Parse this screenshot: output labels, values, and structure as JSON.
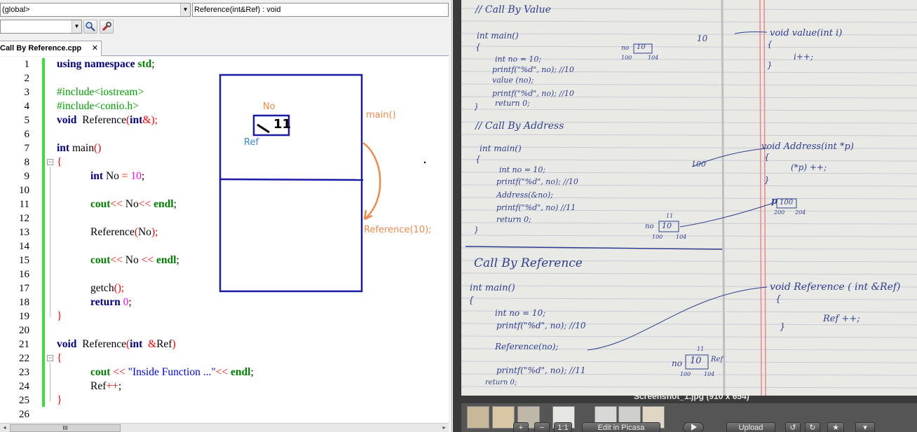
{
  "ide": {
    "scope_combo": "(global>",
    "function_combo": "Reference(int&Ref) : void",
    "search_icon": "search-icon",
    "tools_icon": "wrench-icon",
    "file_tab": "Call By Reference.cpp",
    "tab_close": "✕",
    "line_numbers": [
      "1",
      "2",
      "3",
      "4",
      "5",
      "6",
      "7",
      "8",
      "9",
      "10",
      "11",
      "12",
      "13",
      "14",
      "15",
      "16",
      "17",
      "18",
      "19",
      "20",
      "21",
      "22",
      "23",
      "24",
      "25",
      "26"
    ],
    "code": {
      "l1_kw1": "using",
      "l1_kw2": "namespace",
      "l1_std": "std",
      "l1_end": ";",
      "l3": "#include<iostream>",
      "l4": "#include<conio.h>",
      "l5_void": "void",
      "l5_name": "  Reference",
      "l5_open": "(",
      "l5_int": "int",
      "l5_amp": "&",
      "l5_close": ");",
      "l7_int": "int",
      "l7_main": " main",
      "l7_paren": "()",
      "l8": "{",
      "l9_int": "int",
      "l9_var": " No ",
      "l9_eq": "=",
      "l9_num": " 10",
      "l9_end": ";",
      "l11_cout": "cout",
      "l11_op1": "<<",
      "l11_var": " No",
      "l11_op2": "<<",
      "l11_endl": " endl",
      "l11_end": ";",
      "l13_call": "Reference",
      "l13_open": "(",
      "l13_arg": "No",
      "l13_close": ");",
      "l15_cout": "cout",
      "l15_op1": "<<",
      "l15_var": " No ",
      "l15_op2": "<<",
      "l15_endl": " endl",
      "l15_end": ";",
      "l17_call": "getch",
      "l17_paren": "();",
      "l18_ret": "return",
      "l18_num": " 0",
      "l18_end": ";",
      "l19": "}",
      "l21_void": "void",
      "l21_name": "  Reference",
      "l21_open": "(",
      "l21_int": "int",
      "l21_amp": "  &",
      "l21_ref": "Ref",
      "l21_close": ")",
      "l22": "{",
      "l23_cout": "cout",
      "l23_op1": " <<",
      "l23_str": " \"Inside Function ...\"",
      "l23_op2": "<<",
      "l23_endl": " endl",
      "l23_end": ";",
      "l24_ref": "Ref",
      "l24_op": "++",
      "l24_end": ";",
      "l25": "}"
    },
    "annotations": {
      "no_label": "No",
      "ref_label": "Ref",
      "cell_value": "11",
      "main_label": "main()",
      "call_label": "Reference(10);",
      "ink_blue": "#1a1aa6",
      "ink_orange": "#f08a4b",
      "ref_blue": "#3a86d6"
    },
    "scrollbar_grip": "III",
    "scroll_left": "◂",
    "scroll_right": "▸"
  },
  "viewer": {
    "caption": "Screenshot_1.jpg (910 x 654)",
    "buttons": {
      "plus": "+",
      "minus": "−",
      "one_to_one": "1:1",
      "edit": "Edit in Picasa",
      "upload": "Upload"
    },
    "notes": {
      "h1": "// Call By  Value",
      "h2": "// Call  By  Address",
      "h3": "Call  By  Reference",
      "v_main": "int main()",
      "v_brace": "{",
      "v1": "int no = 10;",
      "v2": "printf(\"%d\", no); //10",
      "v3": "value (no);",
      "v4": "printf(\"%d\", no); //10",
      "v5": "return 0;",
      "v_close": "}",
      "v_fn": "void  value(int i)",
      "v_fn_b": "{",
      "v_fn1": "i++;",
      "v_fn_c": "}",
      "a_main": "int main()",
      "a_brace": "{",
      "a1": "int no = 10;",
      "a2": "printf(\"%d\", no); //10",
      "a3": "Address(&no);",
      "a4": "printf(\"%d\", no) //11",
      "a5": "return 0;",
      "a_close": "}",
      "a_fn": "void  Address(int *p)",
      "a_fn_b": "{",
      "a_fn1": "(*p) ++;",
      "a_fn_c": "}",
      "r_main": "int  main()",
      "r_brace": "{",
      "r1": "int no = 10;",
      "r2": "printf(\"%d\", no); //10",
      "r3": "Reference(no);",
      "r4": "printf(\"%d\", no); //11",
      "r5": "return 0;",
      "r_fn": "void  Reference ( int &Ref)",
      "r_fn_b": "{",
      "r_fn1": "Ref ++;",
      "r_fn_c": "}",
      "box_ten": "10",
      "box_hundred": "100",
      "box_p": "p",
      "box_no": "no",
      "box_ref": "Ref",
      "addr_100": "100",
      "addr_104": "104",
      "addr_200": "200",
      "addr_204": "204",
      "val_10": "10",
      "val_11": "11"
    }
  }
}
